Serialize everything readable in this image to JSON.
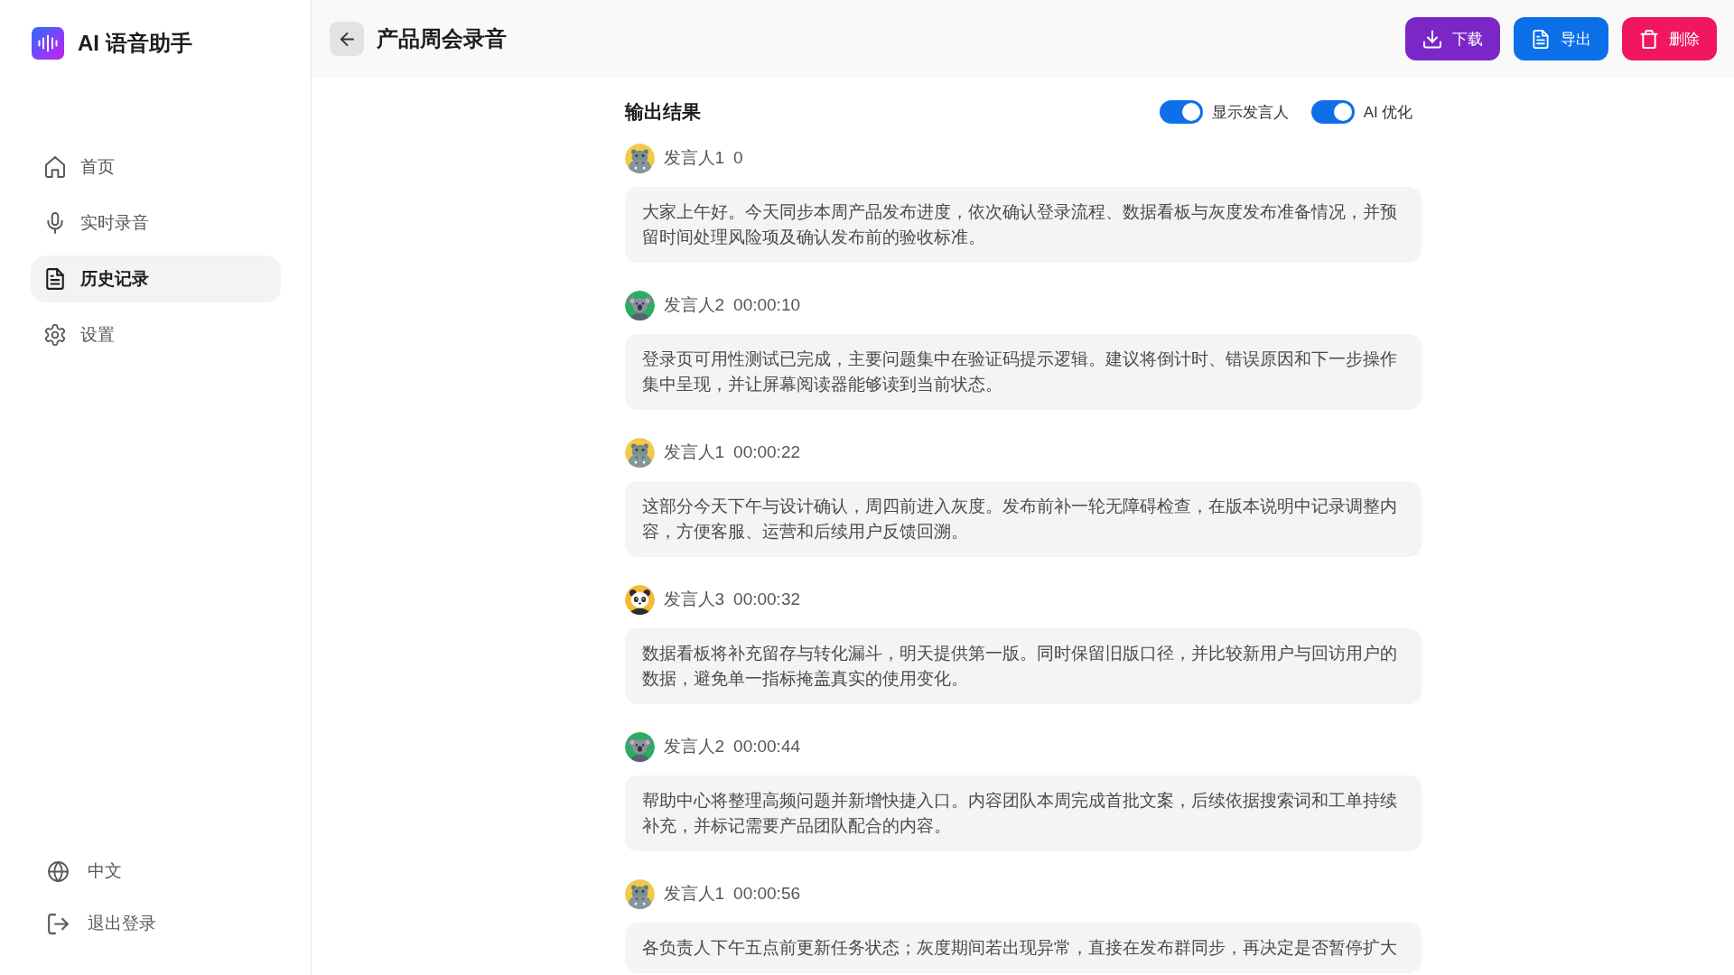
{
  "sidebar": {
    "app_title": "AI 语音助手",
    "nav": [
      {
        "label": "首页",
        "selected": false
      },
      {
        "label": "实时录音",
        "selected": false
      },
      {
        "label": "历史记录",
        "selected": true
      },
      {
        "label": "设置",
        "selected": false
      }
    ],
    "footer": [
      "中文",
      "退出登录"
    ]
  },
  "header": {
    "title": "产品周会录音",
    "buttons": [
      {
        "label": "下载",
        "color": "#7b27c8"
      },
      {
        "label": "导出",
        "color": "#0b70e8"
      },
      {
        "label": "删除",
        "color": "#f0165f"
      }
    ]
  },
  "transcript": {
    "title": "输出结果",
    "toggles": [
      {
        "label": "显示发言人",
        "on": true
      },
      {
        "label": "AI 优化",
        "on": true
      }
    ],
    "messages": [
      {
        "kind": "hippo",
        "speaker": "发言人1",
        "time": "0",
        "text": "大家上午好。今天同步本周产品发布进度，依次确认登录流程、数据看板与灰度发布准备情况，并预留时间处理风险项及确认发布前的验收标准。"
      },
      {
        "kind": "koala",
        "speaker": "发言人2",
        "time": "00:00:10",
        "text": "登录页可用性测试已完成，主要问题集中在验证码提示逻辑。建议将倒计时、错误原因和下一步操作集中呈现，并让屏幕阅读器能够读到当前状态。"
      },
      {
        "kind": "hippo",
        "speaker": "发言人1",
        "time": "00:00:22",
        "text": "这部分今天下午与设计确认，周四前进入灰度。发布前补一轮无障碍检查，在版本说明中记录调整内容，方便客服、运营和后续用户反馈回溯。"
      },
      {
        "kind": "panda",
        "speaker": "发言人3",
        "time": "00:00:32",
        "text": "数据看板将补充留存与转化漏斗，明天提供第一版。同时保留旧版口径，并比较新用户与回访用户的数据，避免单一指标掩盖真实的使用变化。"
      },
      {
        "kind": "koala",
        "speaker": "发言人2",
        "time": "00:00:44",
        "text": "帮助中心将整理高频问题并新增快捷入口。内容团队本周完成首批文案，后续依据搜索词和工单持续补充，并标记需要产品团队配合的内容。"
      },
      {
        "kind": "hippo",
        "speaker": "发言人1",
        "time": "00:00:56",
        "text": "各负责人下午五点前更新任务状态；灰度期间若出现异常，直接在发布群同步，再决定是否暂停扩大"
      }
    ]
  }
}
